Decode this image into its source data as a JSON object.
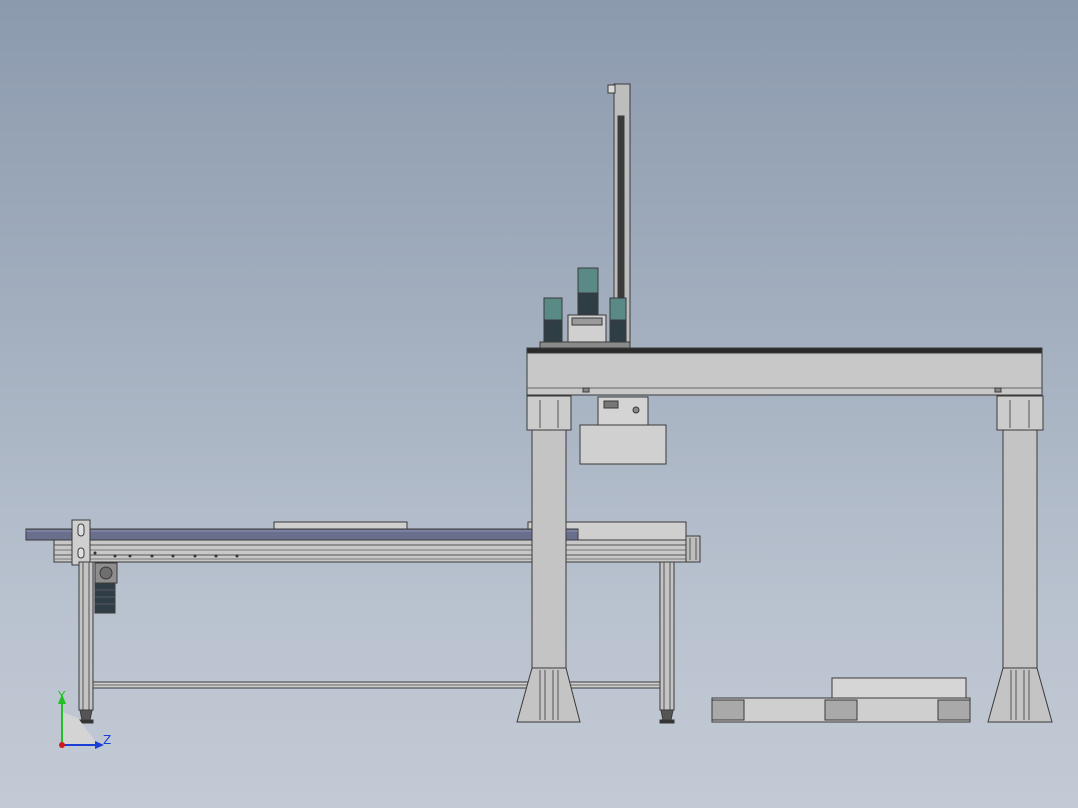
{
  "viewport": {
    "name": "cad-3d-viewport",
    "background_top": "#8c9aae",
    "background_bottom": "#c3cad5"
  },
  "triad": {
    "y_label": "Y",
    "z_label": "Z",
    "y_color": "#22c022",
    "z_color": "#1a3fd6",
    "x_color": "#d11a1a"
  },
  "colors": {
    "steel": "#c4c4c4",
    "steel_dark": "#9e9e9e",
    "belt": "#6a6f8e",
    "edge": "#3a3a3a",
    "motor_teal": "#5a8a86",
    "motor_dark": "#2e3e44"
  },
  "icons": {
    "triad": "coordinate-triad-icon"
  }
}
